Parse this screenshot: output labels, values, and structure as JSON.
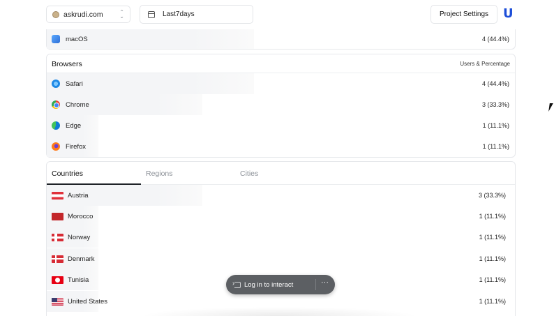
{
  "header": {
    "site": "askrudi.com",
    "range": "Last7days",
    "project_settings": "Project Settings",
    "logo": "U"
  },
  "os": {
    "rows": [
      {
        "name": "macOS",
        "value": "4 (44.4%)",
        "share": 0.444,
        "icon": "apple-finder-icon"
      }
    ]
  },
  "browsers": {
    "title": "Browsers",
    "subtitle": "Users & Percentage",
    "rows": [
      {
        "name": "Safari",
        "value": "4 (44.4%)",
        "share": 0.444,
        "icon": "safari-icon"
      },
      {
        "name": "Chrome",
        "value": "3 (33.3%)",
        "share": 0.333,
        "icon": "chrome-icon"
      },
      {
        "name": "Edge",
        "value": "1 (11.1%)",
        "share": 0.111,
        "icon": "edge-icon"
      },
      {
        "name": "Firefox",
        "value": "1 (11.1%)",
        "share": 0.111,
        "icon": "firefox-icon"
      }
    ]
  },
  "geo": {
    "tabs": [
      "Countries",
      "Regions",
      "Cities"
    ],
    "active_tab": "Countries",
    "rows": [
      {
        "name": "Austria",
        "value": "3 (33.3%)",
        "share": 0.333,
        "flag": "austria-flag-icon"
      },
      {
        "name": "Morocco",
        "value": "1 (11.1%)",
        "share": 0.111,
        "flag": "morocco-flag-icon"
      },
      {
        "name": "Norway",
        "value": "1 (11.1%)",
        "share": 0.111,
        "flag": "norway-flag-icon"
      },
      {
        "name": "Denmark",
        "value": "1 (11.1%)",
        "share": 0.111,
        "flag": "denmark-flag-icon"
      },
      {
        "name": "Tunisia",
        "value": "1 (11.1%)",
        "share": 0.111,
        "flag": "tunisia-flag-icon"
      },
      {
        "name": "United States",
        "value": "1 (11.1%)",
        "share": 0.111,
        "flag": "usa-flag-icon"
      }
    ]
  },
  "toast": {
    "label": "Log in to interact",
    "more": "···"
  },
  "colors": {
    "accent": "#1d4ed8",
    "bar": "#f4f5f7",
    "toast": "#5c5f63"
  }
}
